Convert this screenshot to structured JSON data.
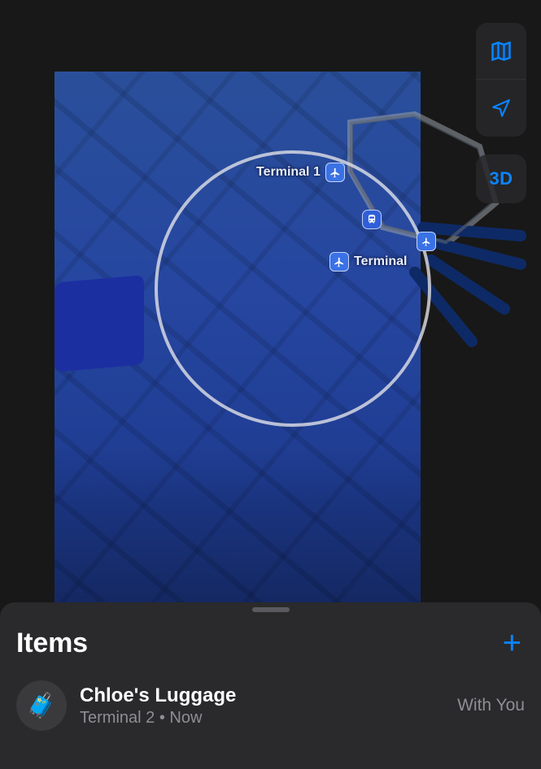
{
  "map": {
    "pois": {
      "terminal1": {
        "label": "Terminal 1",
        "icon": "airplane"
      },
      "terminal": {
        "label": "Terminal",
        "icon": "airplane"
      },
      "transit": {
        "icon": "train"
      }
    },
    "controls": {
      "modes_label": "Map modes",
      "location_label": "Current location",
      "threed_label": "3D"
    },
    "colors": {
      "accent": "#0a84ff",
      "map_fill": "#2646a0"
    }
  },
  "sheet": {
    "title": "Items",
    "add_label": "+",
    "items": [
      {
        "name": "Chloe's Luggage",
        "location": "Terminal 2",
        "time": "Now",
        "separator": " • ",
        "status": "With You",
        "icon": "luggage"
      }
    ]
  }
}
